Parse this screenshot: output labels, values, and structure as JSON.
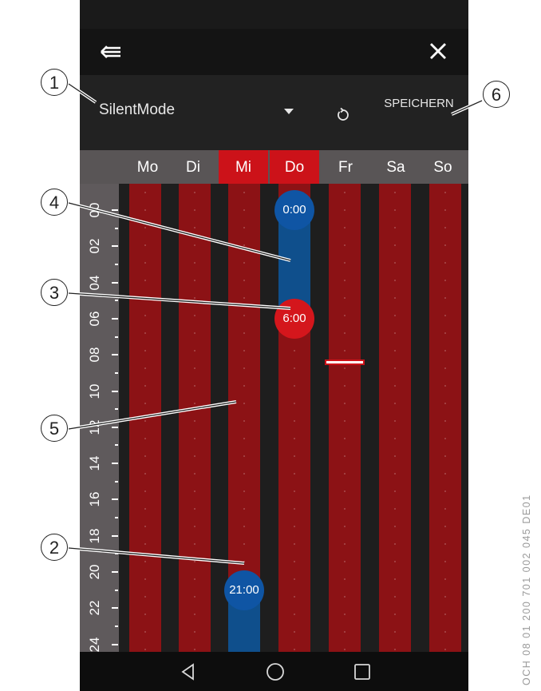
{
  "appbar": {
    "back_icon": "back-arrow-icon",
    "close_icon": "close-icon"
  },
  "toolbar": {
    "mode_value": "SilentMode",
    "reset_icon": "refresh-icon",
    "save_label": "SPEICHERN"
  },
  "days": [
    {
      "label": "Mo",
      "active": false
    },
    {
      "label": "Di",
      "active": false
    },
    {
      "label": "Mi",
      "active": true
    },
    {
      "label": "Do",
      "active": true
    },
    {
      "label": "Fr",
      "active": false
    },
    {
      "label": "Sa",
      "active": false
    },
    {
      "label": "So",
      "active": false
    }
  ],
  "axis": {
    "labels": [
      "00",
      "02",
      "04",
      "06",
      "08",
      "10",
      "12",
      "14",
      "16",
      "18",
      "20",
      "22",
      "24"
    ]
  },
  "schedule": {
    "handles": [
      {
        "day": "Do",
        "time": "0:00",
        "color": "blue"
      },
      {
        "day": "Do",
        "time": "6:00",
        "color": "red"
      },
      {
        "day": "Mi",
        "time": "21:00",
        "color": "blue"
      }
    ],
    "colors": {
      "silent_block": "#0f4f8c",
      "normal_block": "#8c1215",
      "active_day": "#cc1219"
    }
  },
  "navbar": {
    "back_icon": "nav-back-icon",
    "home_icon": "nav-home-icon",
    "recents_icon": "nav-recents-icon"
  },
  "callouts": [
    "1",
    "2",
    "3",
    "4",
    "5",
    "6"
  ],
  "doc_ref": "OCH 08 01 200 701 002 045 DE01"
}
